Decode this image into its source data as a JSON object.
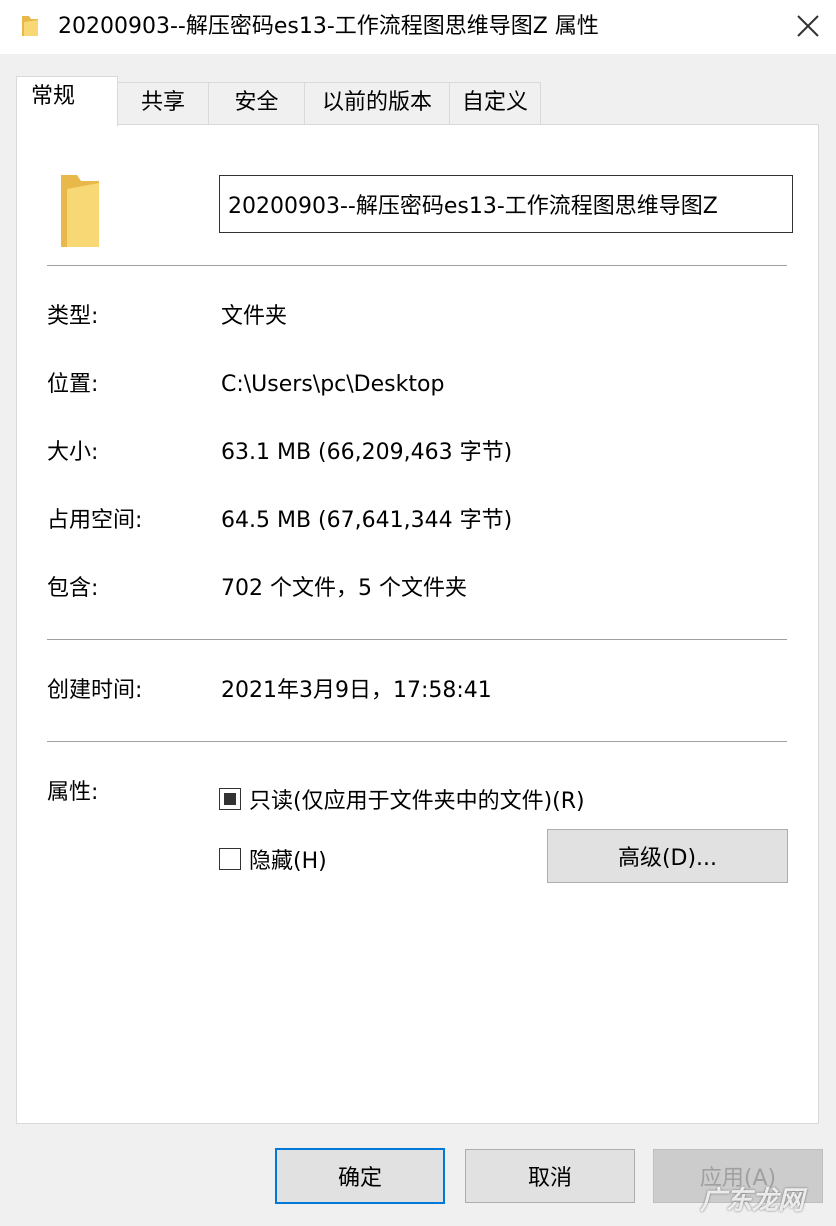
{
  "window": {
    "title": "20200903--解压密码es13-工作流程图思维导图Z 属性"
  },
  "tabs": [
    {
      "label": "常规",
      "active": true
    },
    {
      "label": "共享",
      "active": false
    },
    {
      "label": "安全",
      "active": false
    },
    {
      "label": "以前的版本",
      "active": false
    },
    {
      "label": "自定义",
      "active": false
    }
  ],
  "general": {
    "folder_name": "20200903--解压密码es13-工作流程图思维导图Z",
    "type": {
      "label": "类型:",
      "value": "文件夹"
    },
    "location": {
      "label": "位置:",
      "value": "C:\\Users\\pc\\Desktop"
    },
    "size": {
      "label": "大小:",
      "value": "63.1 MB (66,209,463 字节)"
    },
    "size_on_disk": {
      "label": "占用空间:",
      "value": "64.5 MB (67,641,344 字节)"
    },
    "contains": {
      "label": "包含:",
      "value": "702 个文件，5 个文件夹"
    },
    "created": {
      "label": "创建时间:",
      "value": "2021年3月9日，17:58:41"
    },
    "attributes": {
      "label": "属性:",
      "readonly_label": "只读(仅应用于文件夹中的文件)(R)",
      "readonly_state": "indeterminate",
      "hidden_label": "隐藏(H)",
      "hidden_state": "unchecked",
      "advanced_label": "高级(D)..."
    }
  },
  "footer": {
    "ok_label": "确定",
    "cancel_label": "取消",
    "apply_label": "应用(A)"
  },
  "icons": {
    "title": "folder-icon",
    "close": "close-icon",
    "big": "folder-icon"
  },
  "colors": {
    "folder_yellow": "#f8d775",
    "folder_shade": "#e8b84a",
    "focus_blue": "#0078d7"
  },
  "watermark": "广东龙网"
}
